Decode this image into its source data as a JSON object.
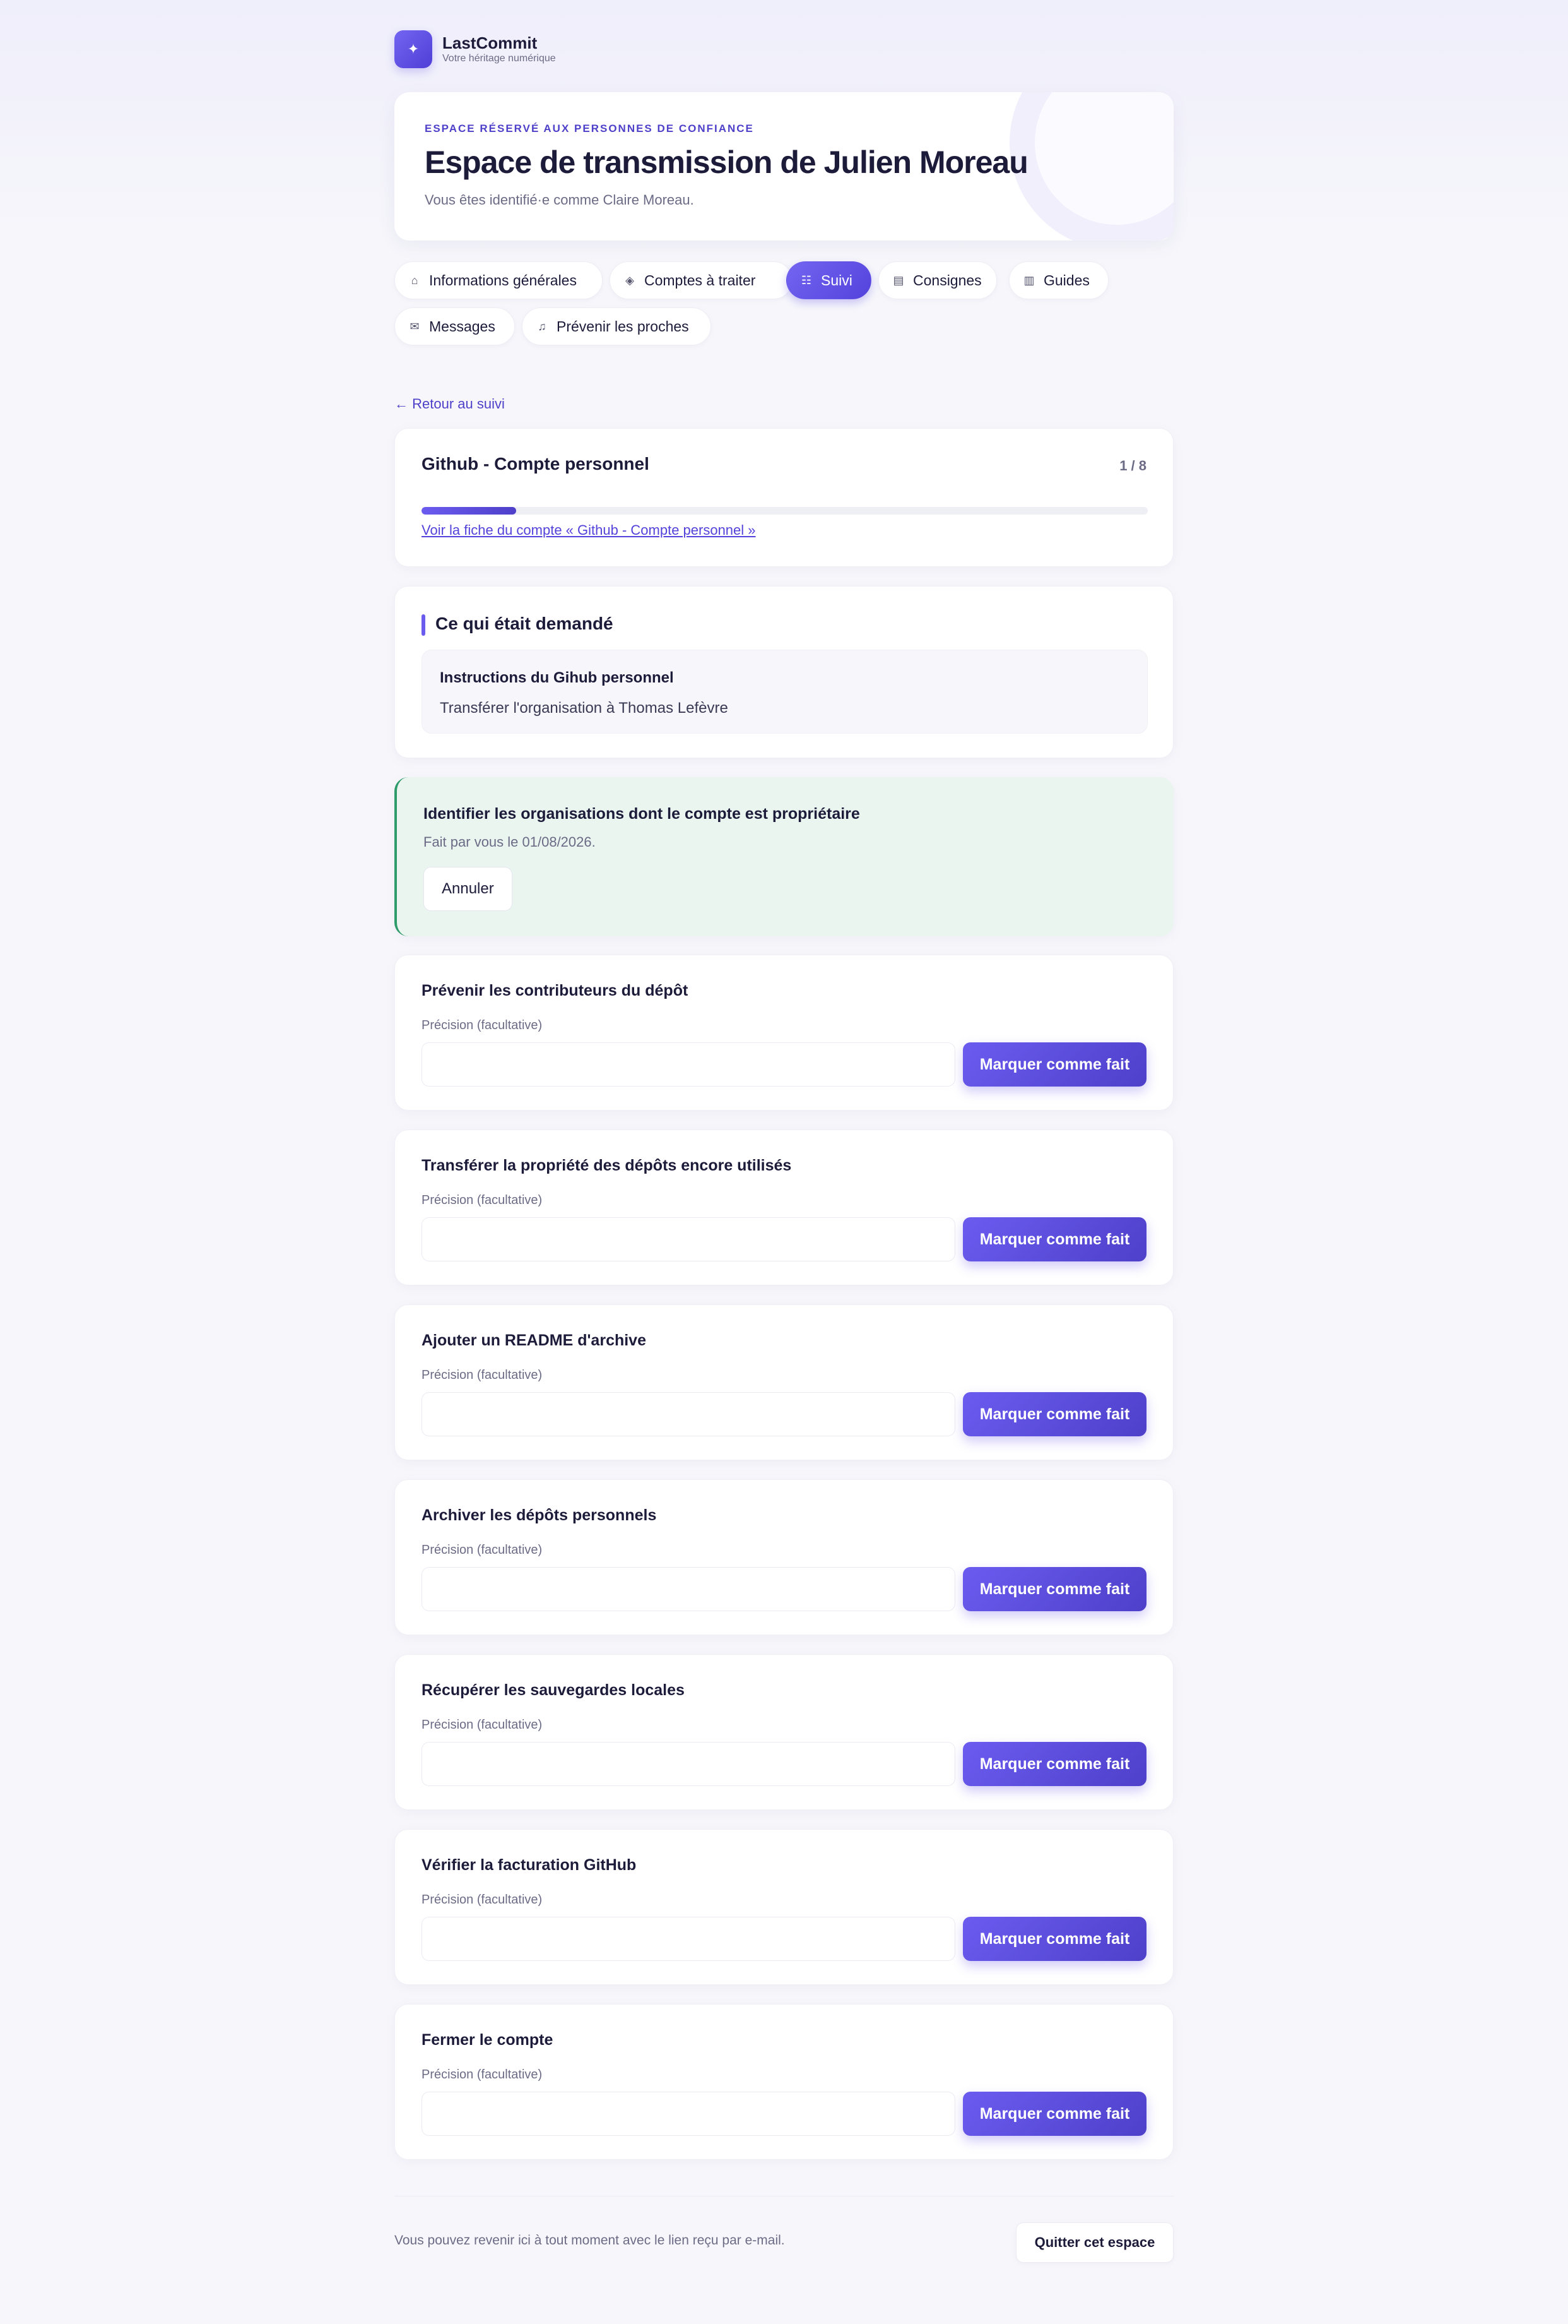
{
  "brand": {
    "name": "LastCommit",
    "tagline": "Votre héritage numérique",
    "logo_icon": "spark-icon"
  },
  "hero": {
    "eyebrow": "ESPACE RÉSERVÉ AUX PERSONNES DE CONFIANCE",
    "title": "Espace de transmission de Julien Moreau",
    "subtitle": "Vous êtes identifié·e comme Claire Moreau."
  },
  "tabs": [
    {
      "label": "Informations générales",
      "icon": "home-icon",
      "glyph": "⌂",
      "active": false
    },
    {
      "label": "Comptes à traiter",
      "icon": "layers-icon",
      "glyph": "◈",
      "active": false
    },
    {
      "label": "Suivi",
      "icon": "list-check-icon",
      "glyph": "☷",
      "active": true
    },
    {
      "label": "Consignes",
      "icon": "document-icon",
      "glyph": "▤",
      "active": false
    },
    {
      "label": "Guides",
      "icon": "book-icon",
      "glyph": "▥",
      "active": false
    },
    {
      "label": "Messages",
      "icon": "mail-icon",
      "glyph": "✉",
      "active": false
    },
    {
      "label": "Prévenir les proches",
      "icon": "bell-icon",
      "glyph": "♫",
      "active": false
    }
  ],
  "back_link": "← Retour au suivi",
  "account": {
    "title": "Github - Compte personnel",
    "counter": "1 / 8",
    "progress": 0.13,
    "link": "Voir la fiche du compte « Github - Compte personnel »"
  },
  "requested": {
    "section_title": "Ce qui était demandé",
    "instructions_title": "Instructions du Gihub personnel",
    "instructions_text": "Transférer l'organisation à Thomas Lefèvre"
  },
  "done_step": {
    "title": "Identifier les organisations dont le compte est propriétaire",
    "meta": "Fait par vous le 01/08/2026.",
    "cancel_label": "Annuler"
  },
  "steps": [
    {
      "title": "Prévenir les contributeurs du dépôt"
    },
    {
      "title": "Transférer la propriété des dépôts encore utilisés"
    },
    {
      "title": "Ajouter un README d'archive"
    },
    {
      "title": "Archiver les dépôts personnels"
    },
    {
      "title": "Récupérer les sauvegardes locales"
    },
    {
      "title": "Vérifier la facturation GitHub"
    },
    {
      "title": "Fermer le compte"
    }
  ],
  "step_common": {
    "precision_label": "Précision (facultative)",
    "input_value": "",
    "button_label": "Marquer comme fait"
  },
  "footer": {
    "text": "Vous pouvez revenir ici à tout moment avec le lien reçu par e-mail.",
    "quit_label": "Quitter cet espace"
  }
}
